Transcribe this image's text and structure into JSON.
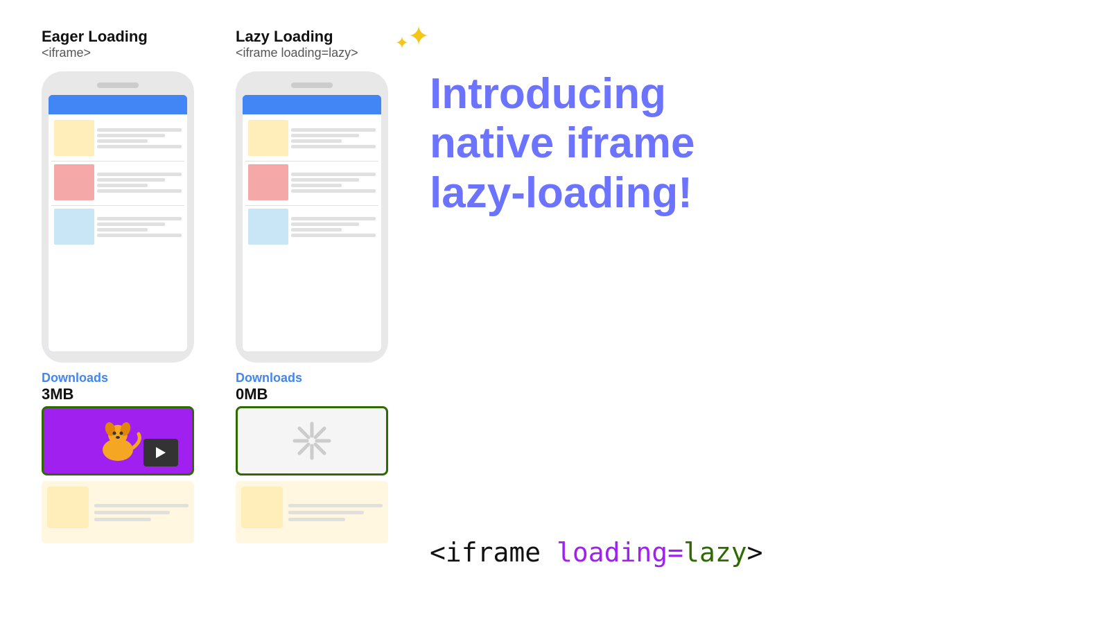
{
  "eager": {
    "title": "Eager Loading",
    "subtitle": "<iframe>",
    "downloads_label": "Downloads",
    "downloads_amount": "3MB"
  },
  "lazy": {
    "title": "Lazy Loading",
    "subtitle": "<iframe loading=lazy>",
    "sparkle": "✦✦",
    "downloads_label": "Downloads",
    "downloads_amount": "0MB"
  },
  "intro": {
    "line1": "Introducing",
    "line2": "native iframe",
    "line3": "lazy-loading!"
  },
  "code_snippet": {
    "prefix": "<iframe",
    "attr_name": " loading=",
    "attr_value": "lazy",
    "suffix": ">"
  },
  "colors": {
    "phone_blue": "#4285f4",
    "text_blue": "#6b73ff",
    "purple": "#a020f0",
    "dark_green": "#2d6a00",
    "yellow": "#f5c518",
    "dog_orange": "#f5a623",
    "cream": "#ffeeba",
    "salmon": "#f4a8a8",
    "light_blue_block": "#c8e6f5",
    "content_bg": "#ffffff",
    "lines_bg": "#e0e0e0"
  }
}
